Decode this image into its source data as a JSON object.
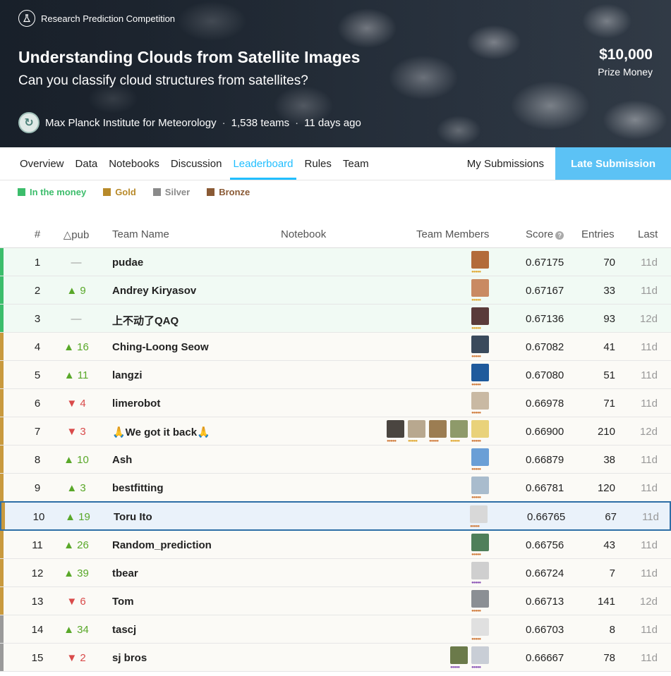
{
  "banner": {
    "competition_type": "Research Prediction Competition",
    "title": "Understanding Clouds from Satellite Images",
    "subtitle": "Can you classify cloud structures from satellites?",
    "prize_amount": "$10,000",
    "prize_label": "Prize Money",
    "host": "Max Planck Institute for Meteorology",
    "teams": "1,538 teams",
    "time_ago": "11 days ago"
  },
  "tabs": [
    "Overview",
    "Data",
    "Notebooks",
    "Discussion",
    "Leaderboard",
    "Rules",
    "Team"
  ],
  "active_tab": "Leaderboard",
  "my_submissions": "My Submissions",
  "late_submission": "Late Submission",
  "legend": [
    {
      "label": "In the money",
      "color": "#3cbd6b"
    },
    {
      "label": "Gold",
      "color": "#b88a2a"
    },
    {
      "label": "Silver",
      "color": "#8a8a8a"
    },
    {
      "label": "Bronze",
      "color": "#8a5a35"
    }
  ],
  "headers": {
    "rank": "#",
    "change": "△pub",
    "team": "Team Name",
    "notebook": "Notebook",
    "members": "Team Members",
    "score": "Score",
    "entries": "Entries",
    "last": "Last"
  },
  "rows": [
    {
      "rank": "1",
      "change": "—",
      "dir": "flat",
      "team": "pudae",
      "score": "0.67175",
      "entries": "70",
      "last": "11d",
      "zone": "money",
      "bar": "#3cbd6b",
      "avatars": [
        {
          "c": "#b36b3a",
          "tier": "gold"
        }
      ]
    },
    {
      "rank": "2",
      "change": "▲ 9",
      "dir": "up",
      "team": "Andrey Kiryasov",
      "score": "0.67167",
      "entries": "33",
      "last": "11d",
      "zone": "money",
      "bar": "#3cbd6b",
      "avatars": [
        {
          "c": "#c98a62",
          "tier": "gold"
        }
      ]
    },
    {
      "rank": "3",
      "change": "—",
      "dir": "flat",
      "team": "上不动了QAQ",
      "score": "0.67136",
      "entries": "93",
      "last": "12d",
      "zone": "money",
      "bar": "#3cbd6b",
      "avatars": [
        {
          "c": "#5a3b3a",
          "tier": "gold"
        }
      ]
    },
    {
      "rank": "4",
      "change": "▲ 16",
      "dir": "up",
      "team": "Ching-Loong Seow",
      "score": "0.67082",
      "entries": "41",
      "last": "11d",
      "zone": "medal",
      "bar": "#c99a3e",
      "avatars": [
        {
          "c": "#3a4a5c",
          "tier": "bronze"
        }
      ]
    },
    {
      "rank": "5",
      "change": "▲ 11",
      "dir": "up",
      "team": "langzi",
      "score": "0.67080",
      "entries": "51",
      "last": "11d",
      "zone": "medal",
      "bar": "#c99a3e",
      "avatars": [
        {
          "c": "#1e5a9c",
          "tier": "bronze"
        }
      ]
    },
    {
      "rank": "6",
      "change": "▼ 4",
      "dir": "down",
      "team": "limerobot",
      "score": "0.66978",
      "entries": "71",
      "last": "11d",
      "zone": "medal",
      "bar": "#c99a3e",
      "avatars": [
        {
          "c": "#c9b9a3",
          "tier": "bronze"
        }
      ]
    },
    {
      "rank": "7",
      "change": "▼ 3",
      "dir": "down",
      "team": "🙏We got it back🙏",
      "score": "0.66900",
      "entries": "210",
      "last": "12d",
      "zone": "medal",
      "bar": "#c99a3e",
      "avatars": [
        {
          "c": "#4a4540",
          "tier": "bronze"
        },
        {
          "c": "#b8a88f",
          "tier": "gold"
        },
        {
          "c": "#9c7d52",
          "tier": "bronze"
        },
        {
          "c": "#8e9a6a",
          "tier": "gold"
        },
        {
          "c": "#e9d27a",
          "tier": "bronze"
        }
      ]
    },
    {
      "rank": "8",
      "change": "▲ 10",
      "dir": "up",
      "team": "Ash",
      "score": "0.66879",
      "entries": "38",
      "last": "11d",
      "zone": "medal",
      "bar": "#c99a3e",
      "avatars": [
        {
          "c": "#6a9fd6",
          "tier": "bronze"
        }
      ]
    },
    {
      "rank": "9",
      "change": "▲ 3",
      "dir": "up",
      "team": "bestfitting",
      "score": "0.66781",
      "entries": "120",
      "last": "11d",
      "zone": "medal",
      "bar": "#c99a3e",
      "avatars": [
        {
          "c": "#a9bccd",
          "tier": "bronze"
        }
      ]
    },
    {
      "rank": "10",
      "change": "▲ 19",
      "dir": "up",
      "team": "Toru Ito",
      "score": "0.66765",
      "entries": "67",
      "last": "11d",
      "zone": "highlight",
      "bar": "#c99a3e",
      "avatars": [
        {
          "c": "#d8d8d8",
          "tier": "bronze"
        }
      ]
    },
    {
      "rank": "11",
      "change": "▲ 26",
      "dir": "up",
      "team": "Random_prediction",
      "score": "0.66756",
      "entries": "43",
      "last": "11d",
      "zone": "medal",
      "bar": "#c99a3e",
      "avatars": [
        {
          "c": "#4f7f5a",
          "tier": "bronze"
        }
      ]
    },
    {
      "rank": "12",
      "change": "▲ 39",
      "dir": "up",
      "team": "tbear",
      "score": "0.66724",
      "entries": "7",
      "last": "11d",
      "zone": "medal",
      "bar": "#c99a3e",
      "avatars": [
        {
          "c": "#cfcfcf",
          "tier": "purple"
        }
      ]
    },
    {
      "rank": "13",
      "change": "▼ 6",
      "dir": "down",
      "team": "Tom",
      "score": "0.66713",
      "entries": "141",
      "last": "12d",
      "zone": "medal",
      "bar": "#c99a3e",
      "avatars": [
        {
          "c": "#8b8f94",
          "tier": "bronze"
        }
      ]
    },
    {
      "rank": "14",
      "change": "▲ 34",
      "dir": "up",
      "team": "tascj",
      "score": "0.66703",
      "entries": "8",
      "last": "11d",
      "zone": "medal",
      "bar": "#9a9a9a",
      "avatars": [
        {
          "c": "#e0e0e0",
          "tier": "bronze"
        }
      ]
    },
    {
      "rank": "15",
      "change": "▼ 2",
      "dir": "down",
      "team": "sj bros",
      "score": "0.66667",
      "entries": "78",
      "last": "11d",
      "zone": "medal",
      "bar": "#9a9a9a",
      "avatars": [
        {
          "c": "#6b7a4a",
          "tier": "purple"
        },
        {
          "c": "#c9ced6",
          "tier": "purple"
        }
      ]
    }
  ]
}
